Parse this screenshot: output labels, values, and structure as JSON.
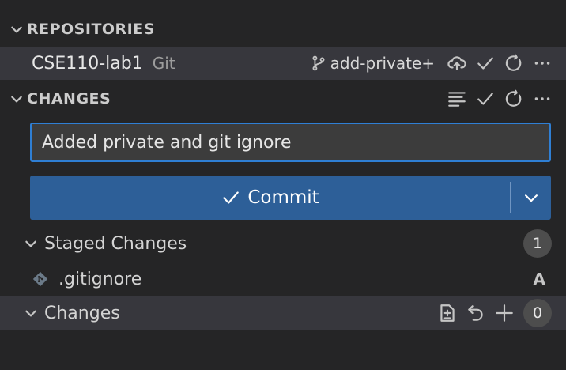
{
  "repositories": {
    "title": "REPOSITORIES",
    "repo": {
      "name": "CSE110-lab1",
      "provider": "Git",
      "branch": "add-private+"
    }
  },
  "changes": {
    "title": "CHANGES",
    "commit_message": "Added private and git ignore",
    "commit_label": "Commit",
    "groups": {
      "staged": {
        "label": "Staged Changes",
        "count": "1",
        "files": [
          {
            "name": ".gitignore",
            "status": "A"
          }
        ]
      },
      "unstaged": {
        "label": "Changes",
        "count": "0"
      }
    }
  },
  "icons": {
    "branch": "source-branch-icon",
    "publish": "cloud-upload-icon",
    "check": "check-icon",
    "refresh": "refresh-icon",
    "more": "ellipsis-icon",
    "tree": "list-tree-icon",
    "open_file": "open-file-icon",
    "discard": "discard-icon",
    "add": "plus-icon",
    "git_file": "git-file-icon"
  },
  "colors": {
    "background": "#252526",
    "selected_row": "#37373d",
    "commit_button": "#2d5f98",
    "input_border": "#2f7fd4"
  }
}
